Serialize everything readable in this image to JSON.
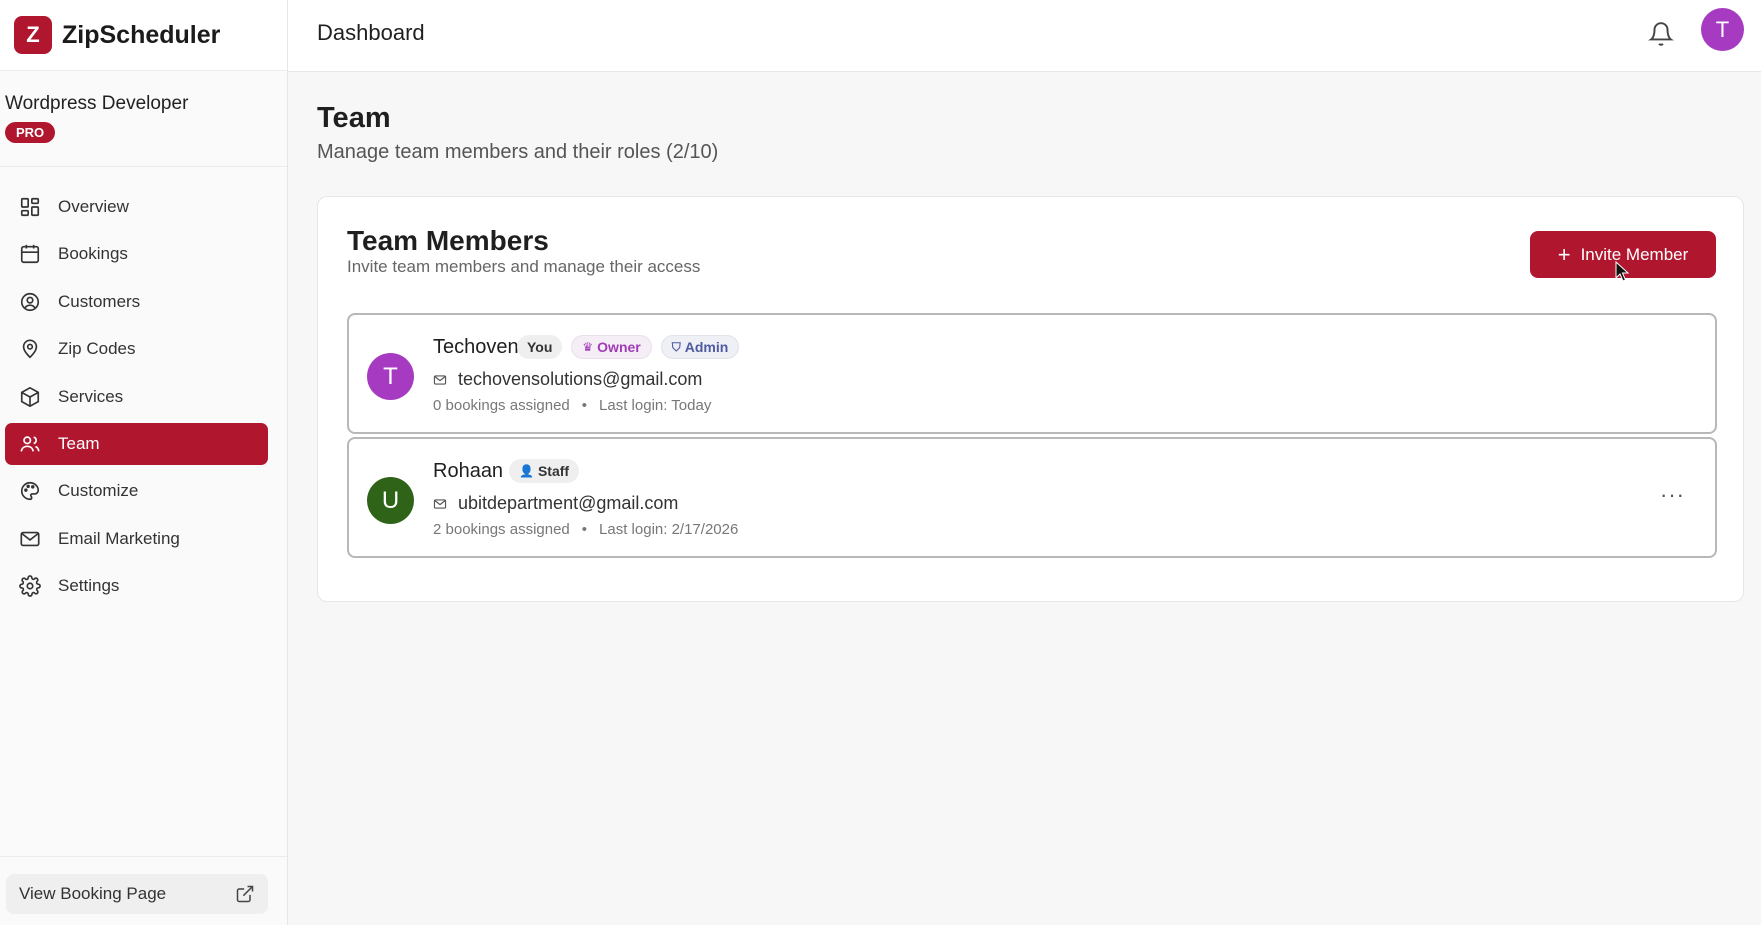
{
  "app": {
    "logo_letter": "Z",
    "name": "ZipScheduler",
    "brand_color": "#b0172f"
  },
  "workspace": {
    "name": "Wordpress Developer",
    "plan_badge": "PRO"
  },
  "sidebar": {
    "items": [
      {
        "label": "Overview",
        "icon": "overview-icon",
        "active": false
      },
      {
        "label": "Bookings",
        "icon": "calendar-icon",
        "active": false
      },
      {
        "label": "Customers",
        "icon": "user-circle-icon",
        "active": false
      },
      {
        "label": "Zip Codes",
        "icon": "map-pin-icon",
        "active": false
      },
      {
        "label": "Services",
        "icon": "box-icon",
        "active": false
      },
      {
        "label": "Team",
        "icon": "users-icon",
        "active": true
      },
      {
        "label": "Customize",
        "icon": "palette-icon",
        "active": false
      },
      {
        "label": "Email Marketing",
        "icon": "mail-icon",
        "active": false
      },
      {
        "label": "Settings",
        "icon": "gear-icon",
        "active": false
      }
    ],
    "footer_link": "View Booking Page"
  },
  "topbar": {
    "title": "Dashboard",
    "user_initial": "T"
  },
  "page": {
    "title": "Team",
    "subtitle": "Manage team members and their roles (2/10)"
  },
  "card": {
    "title": "Team Members",
    "subtitle": "Invite team members and manage their access",
    "invite_label": "Invite Member"
  },
  "members": [
    {
      "initial": "T",
      "avatar_color": "#a63bc1",
      "name": "Techoven",
      "badges": [
        {
          "label": "You",
          "type": "you"
        },
        {
          "label": "Owner",
          "type": "owner"
        },
        {
          "label": "Admin",
          "type": "admin"
        }
      ],
      "email": "techovensolutions@gmail.com",
      "bookings": "0 bookings assigned",
      "last_login": "Last login: Today"
    },
    {
      "initial": "U",
      "avatar_color": "#2f6317",
      "name": "Rohaan",
      "badges": [
        {
          "label": "Staff",
          "type": "staff"
        }
      ],
      "email": "ubitdepartment@gmail.com",
      "bookings": "2 bookings assigned",
      "last_login": "Last login: 2/17/2026",
      "has_menu": true
    }
  ]
}
